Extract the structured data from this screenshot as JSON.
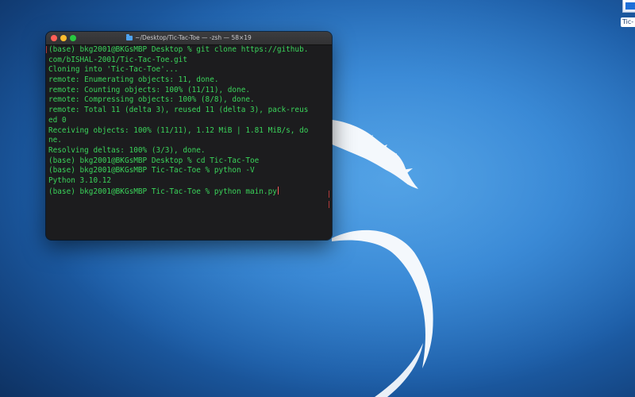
{
  "colors": {
    "terminal_bg": "#1c1c1e",
    "terminal_text": "#3ad35a",
    "cursor": "#ff5a5a",
    "close": "#ff5f57",
    "minimize": "#febc2e",
    "zoom": "#28c840",
    "wallpaper": "#2f7fcf"
  },
  "desktop": {
    "file_icon_label": "Tic-"
  },
  "terminal": {
    "title": "~/Desktop/Tic-Tac-Toe — -zsh — 58×19",
    "lines": [
      "(base) bkg2001@BKGsMBP Desktop % git clone https://github.",
      "com/bISHAL-2001/Tic-Tac-Toe.git",
      "Cloning into 'Tic-Tac-Toe'...",
      "remote: Enumerating objects: 11, done.",
      "remote: Counting objects: 100% (11/11), done.",
      "remote: Compressing objects: 100% (8/8), done.",
      "remote: Total 11 (delta 3), reused 11 (delta 3), pack-reus",
      "ed 0",
      "Receiving objects: 100% (11/11), 1.12 MiB | 1.81 MiB/s, do",
      "ne.",
      "Resolving deltas: 100% (3/3), done.",
      "(base) bkg2001@BKGsMBP Desktop % cd Tic-Tac-Toe",
      "(base) bkg2001@BKGsMBP Tic-Tac-Toe % python -V",
      "Python 3.10.12",
      "(base) bkg2001@BKGsMBP Tic-Tac-Toe % python main.py"
    ]
  }
}
